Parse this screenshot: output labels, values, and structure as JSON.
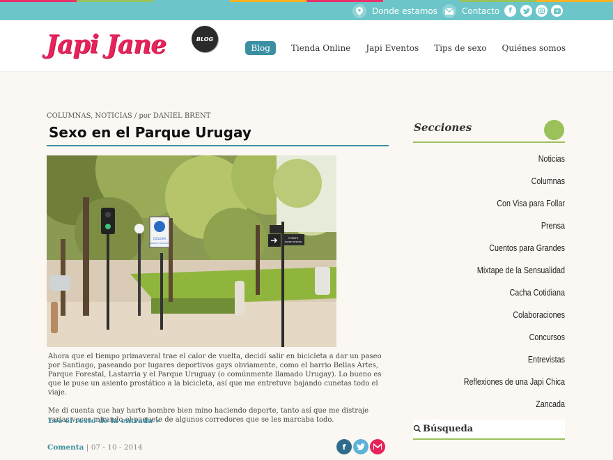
{
  "top_bar": {
    "location_label": "Donde estamos",
    "contact_label": "Contacto",
    "social": [
      "facebook-icon",
      "twitter-icon",
      "instagram-icon",
      "youtube-icon"
    ],
    "strip_colors": [
      "#e8326e",
      "#9bc15b",
      "#6cc6c9",
      "#f6b324",
      "#e8326e",
      "#6cc6c9",
      "#9bc15b",
      "#f6b324"
    ]
  },
  "header": {
    "logo_text": "Japi Jane",
    "logo_badge": "BLOG",
    "nav": [
      "Blog",
      "Tienda Online",
      "Japi Eventos",
      "Tips de sexo",
      "Quiénes somos"
    ],
    "active_nav": "Blog"
  },
  "post": {
    "categories": "COLUMNAS, NOTICIAS",
    "by": "/ por",
    "author": "DANIEL BRENT",
    "title": "Sexo en el Parque Urugay",
    "paragraph1": "Ahora que el tiempo primaveral trae el calor de vuelta, decidí salir en bicicleta a dar un paseo por Santiago, paseando por lugares deportivos gays obviamente, como el barrio Bellas Artes, Parque Forestal, Lastarria y el Parque Uruguay (o comúnmente llamado Urugay). Lo bueno es que le puse un asiento prostático a la bicicleta, así que me entretuve bajando cunetas todo el viaje.",
    "paragraph2": "Me di cuenta que hay harto hombre bien mino haciendo deporte, tanto así que me distraje varias veces mirando el paquete de algunos corredores que se les marcaba todo.",
    "read_more": "Lee el resto de la entrada »",
    "comment_label": "Comenta",
    "separator": "|",
    "date": "07 - 10 - 2014",
    "image_signs": {
      "bike_sign": "CICLOVIA",
      "bike_sign_sub": "PARQUE URUGUAY",
      "street_sign": "PUENTE",
      "street_sign_sub": "PADRE LETELIER"
    }
  },
  "sidebar": {
    "title": "Secciones",
    "sections": [
      "Noticias",
      "Columnas",
      "Con Visa para Follar",
      "Prensa",
      "Cuentos para Grandes",
      "Mixtape de la Sensualidad",
      "Cacha Cotidiana",
      "Colaboraciones",
      "Concursos",
      "Entrevistas",
      "Reflexiones de una Japi Chica",
      "Zancada"
    ],
    "search_label": "Búsqueda"
  },
  "colors": {
    "brand_pink": "#e4245b",
    "teal": "#3a8fa3",
    "top_bar": "#6cc6c9",
    "green": "#9bc15b"
  }
}
